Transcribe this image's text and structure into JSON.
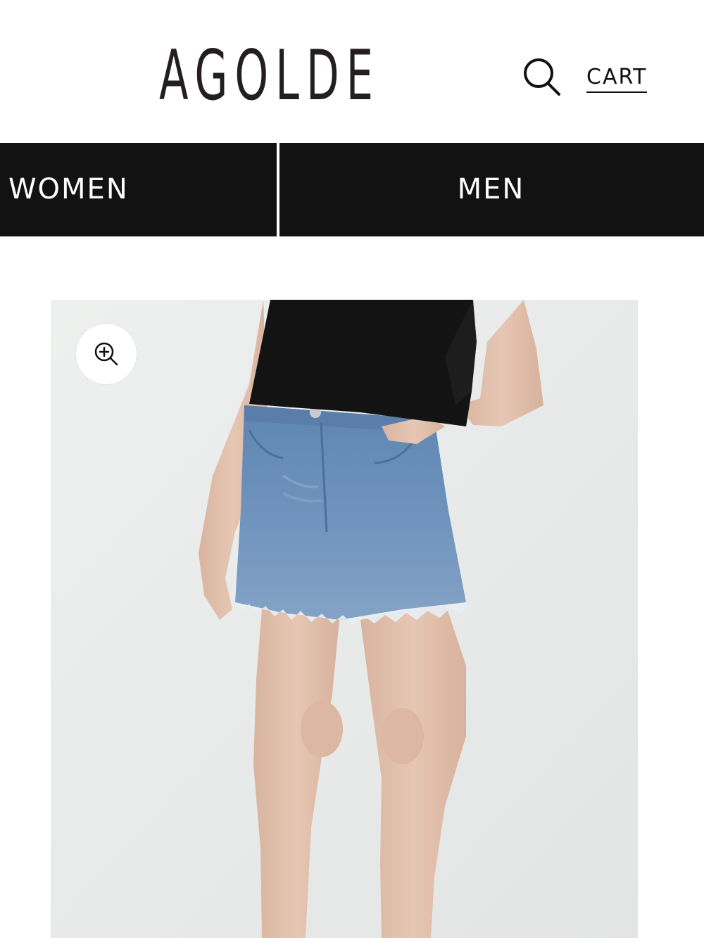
{
  "header": {
    "logo_text": "AGOLDE",
    "search_icon": "search-icon",
    "cart_label": "CART"
  },
  "nav": {
    "tabs": [
      {
        "label": "WOMEN"
      },
      {
        "label": "MEN"
      }
    ]
  },
  "product": {
    "zoom_icon": "zoom-in-icon",
    "image_description": "",
    "colors": {
      "background": "#e9ebea",
      "top": "#131313",
      "denim": "#6a8db4",
      "skin": "#e2c2ae"
    }
  },
  "colors": {
    "nav_background": "#121212",
    "nav_text": "#ffffff",
    "logo": "#231f20"
  }
}
